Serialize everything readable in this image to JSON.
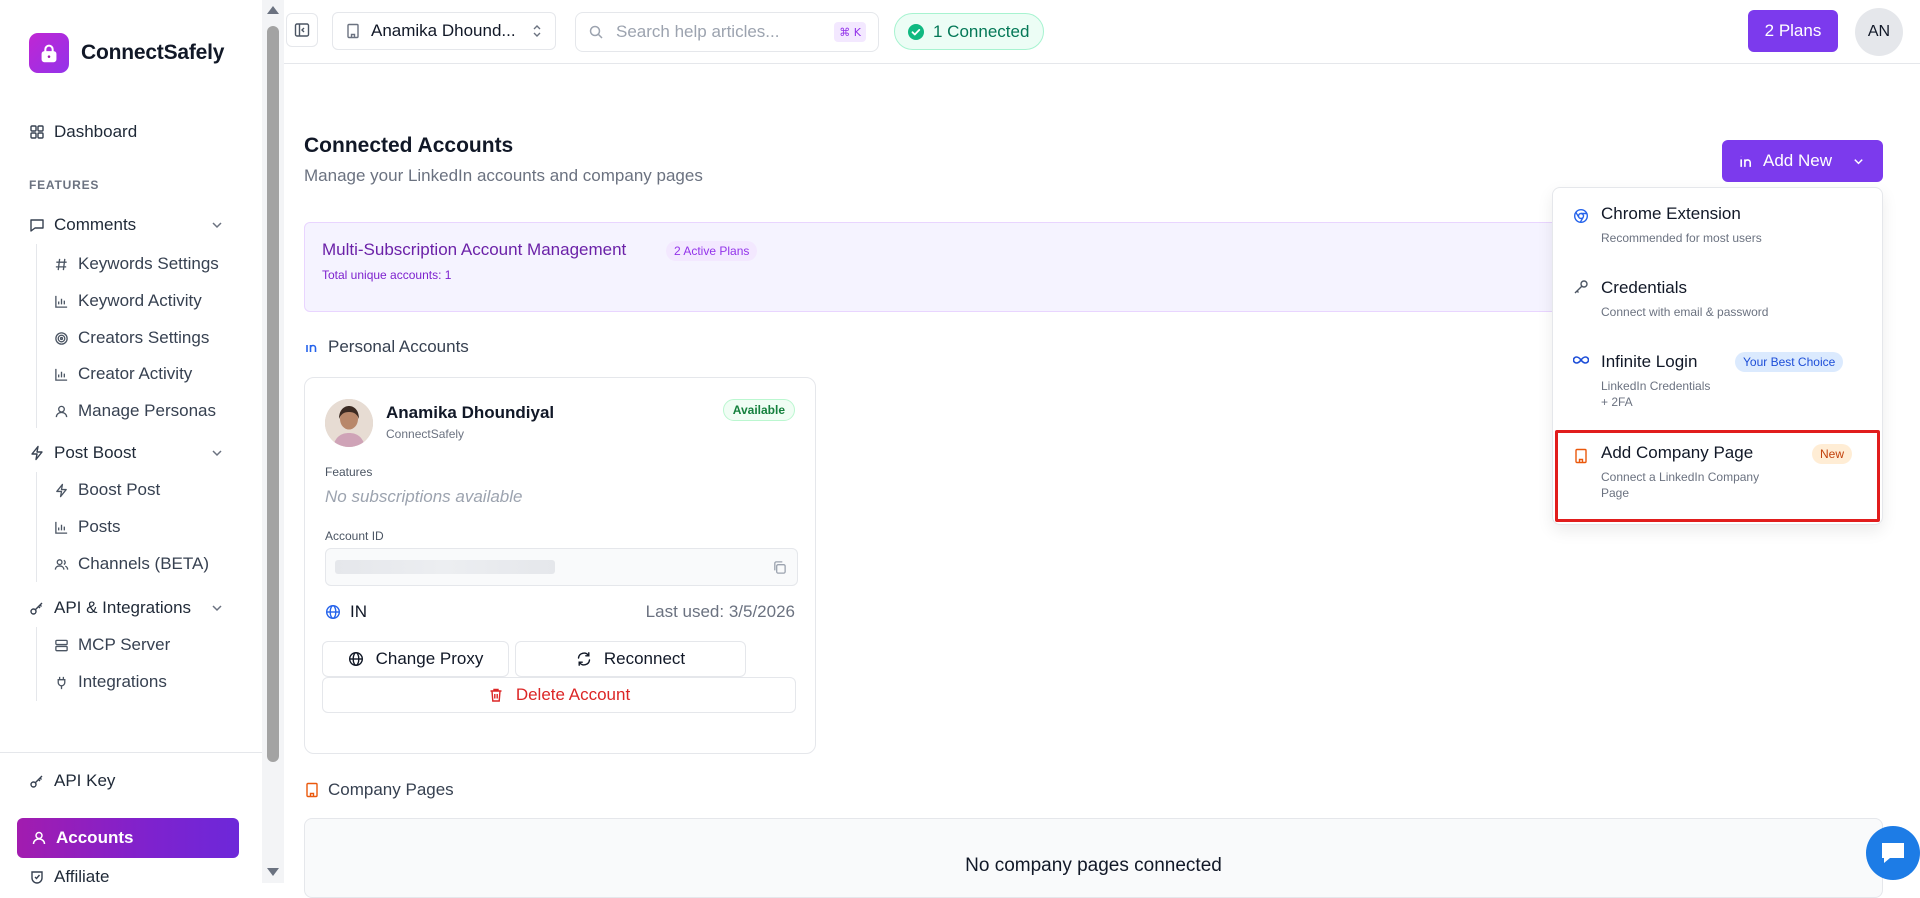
{
  "brand": {
    "name": "ConnectSafely"
  },
  "sidebar": {
    "dashboard": "Dashboard",
    "features_label": "FEATURES",
    "comments": {
      "label": "Comments",
      "items": [
        "Keywords Settings",
        "Keyword Activity",
        "Creators Settings",
        "Creator Activity",
        "Manage Personas"
      ]
    },
    "post_boost": {
      "label": "Post Boost",
      "items": [
        "Boost Post",
        "Posts",
        "Channels (BETA)"
      ]
    },
    "api": {
      "label": "API & Integrations",
      "items": [
        "MCP Server",
        "Integrations"
      ]
    },
    "api_key": "API Key",
    "accounts": "Accounts",
    "affiliate": "Affiliate"
  },
  "header": {
    "workspace": "Anamika Dhound...",
    "search_placeholder": "Search help articles...",
    "shortcut": "⌘ K",
    "connected": "1 Connected",
    "plans": "2 Plans",
    "avatar_initials": "AN"
  },
  "main": {
    "title": "Connected Accounts",
    "subtitle": "Manage your LinkedIn accounts and company pages",
    "add_new": "Add New",
    "multi": {
      "title": "Multi-Subscription Account Management",
      "badge": "2 Active Plans",
      "total": "Total unique accounts: 1"
    },
    "personal_heading": "Personal Accounts",
    "account": {
      "name": "Anamika Dhoundiyal",
      "org": "ConnectSafely",
      "status": "Available",
      "features_label": "Features",
      "no_subscriptions": "No subscriptions available",
      "account_id_label": "Account ID",
      "country": "IN",
      "last_used": "Last used: 3/5/2026",
      "change_proxy": "Change Proxy",
      "reconnect": "Reconnect",
      "delete": "Delete Account"
    },
    "company_heading": "Company Pages",
    "no_company": "No company pages connected"
  },
  "dropdown": {
    "items": [
      {
        "title": "Chrome Extension",
        "desc": "Recommended for most users",
        "icon": "chrome-icon"
      },
      {
        "title": "Credentials",
        "desc": "Connect with email & password",
        "icon": "key-icon"
      },
      {
        "title": "Infinite Login",
        "desc_line1": "LinkedIn Credentials",
        "desc_line2": "+ 2FA",
        "badge": "Your Best Choice",
        "icon": "infinity-icon"
      },
      {
        "title": "Add Company Page",
        "desc_line1": "Connect a LinkedIn Company",
        "desc_line2": "Page",
        "badge": "New",
        "icon": "building-icon"
      }
    ]
  },
  "colors": {
    "brand_purple": "#7c3aed",
    "highlight_red": "#e11d1d",
    "connected_green": "#047857",
    "danger": "#dc2626"
  }
}
